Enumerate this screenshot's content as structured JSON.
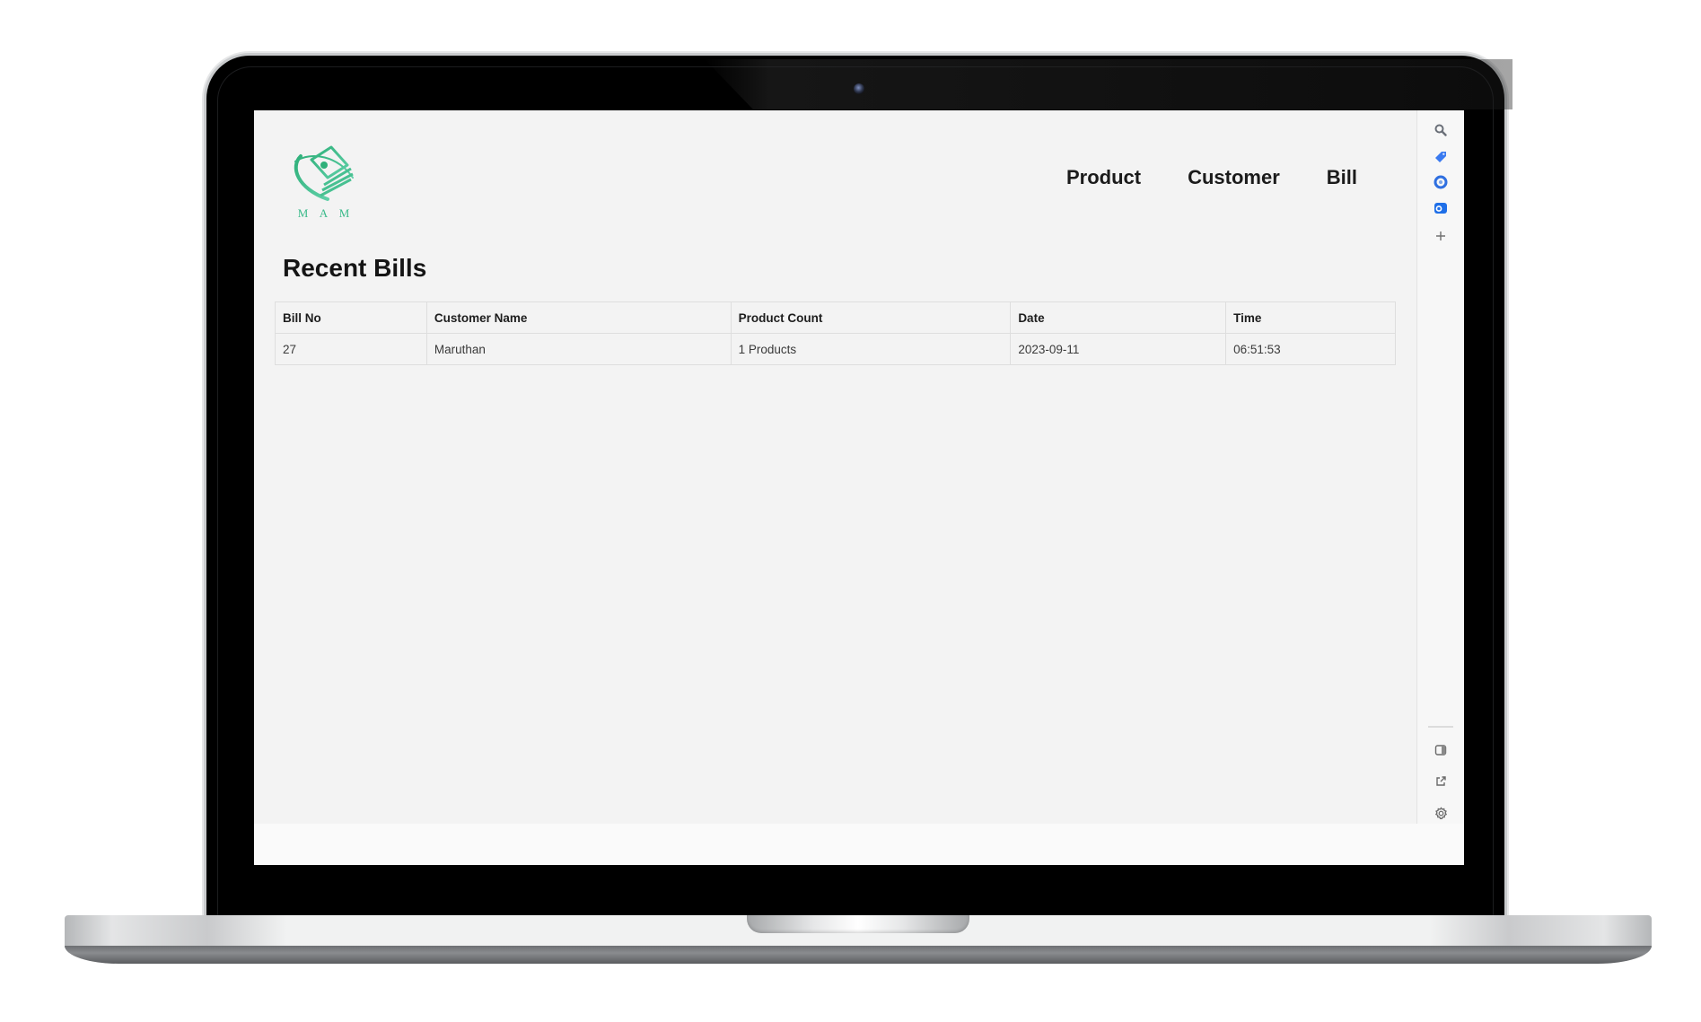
{
  "app": {
    "logo_text": "M A M",
    "nav": [
      {
        "label": "Product"
      },
      {
        "label": "Customer"
      },
      {
        "label": "Bill"
      }
    ]
  },
  "main": {
    "title": "Recent Bills",
    "table": {
      "columns": [
        "Bill No",
        "Customer Name",
        "Product Count",
        "Date",
        "Time"
      ],
      "rows": [
        [
          "27",
          "Maruthan",
          "1 Products",
          "2023-09-11",
          "06:51:53"
        ]
      ]
    }
  },
  "side_panel": {
    "top_icons": [
      "search-icon",
      "tag-icon",
      "copilot-icon",
      "outlook-icon",
      "add-icon"
    ],
    "bottom_icons": [
      "split-screen-icon",
      "open-external-icon",
      "settings-icon"
    ]
  },
  "colors": {
    "brand_green": "#3aba8a",
    "accent_blue": "#2f6fe0",
    "page_bg": "#f3f3f3",
    "text_dark": "#1b1b1b"
  }
}
